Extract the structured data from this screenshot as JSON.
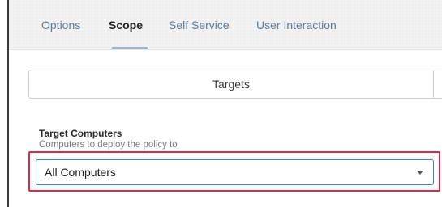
{
  "tabs": [
    {
      "label": "Options",
      "active": false
    },
    {
      "label": "Scope",
      "active": true
    },
    {
      "label": "Self Service",
      "active": false
    },
    {
      "label": "User Interaction",
      "active": false
    }
  ],
  "segmented_control": {
    "items": [
      "Targets"
    ]
  },
  "target_computers": {
    "label": "Target Computers",
    "help_text": "Computers to deploy the policy to",
    "selected_value": "All Computers"
  },
  "colors": {
    "active_tab_text": "#232323",
    "inactive_tab_text": "#5d7a95",
    "tab_underline": "#9fb5c9",
    "select_border": "#3f7fc1",
    "highlight_outline": "#e0294a"
  },
  "icons": {
    "select_caret": "caret-down-icon"
  }
}
